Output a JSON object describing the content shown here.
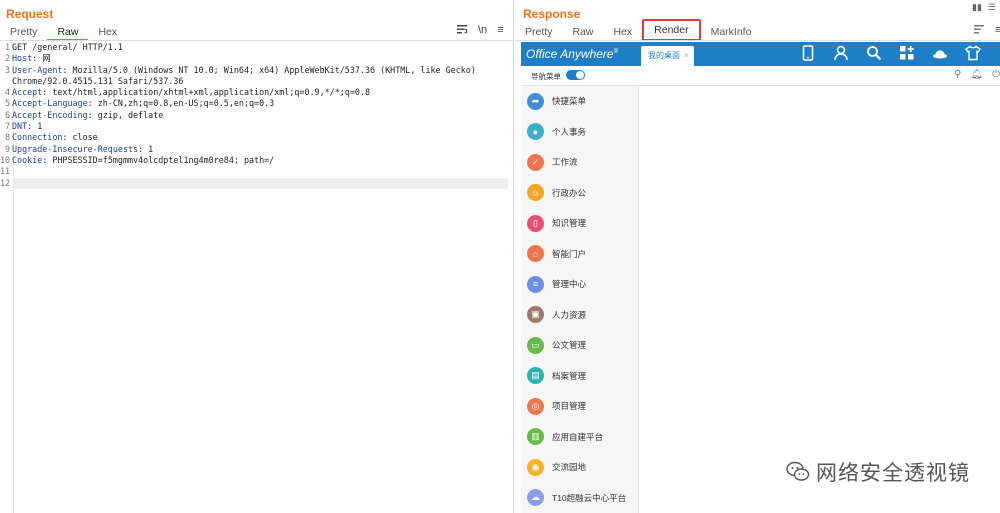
{
  "request": {
    "title": "Request",
    "tabs": [
      "Pretty",
      "Raw",
      "Hex"
    ],
    "active_tab": "Raw",
    "tools": [
      "wrap-icon",
      "newline-toggle",
      "menu-icon"
    ],
    "newline_label": "\\n",
    "lines": [
      {
        "n": "1",
        "key": "",
        "val": "GET /general/ HTTP/1.1"
      },
      {
        "n": "2",
        "key": "Host",
        "val": ": 网"
      },
      {
        "n": "3",
        "key": "User-Agent",
        "val": ": Mozilla/5.0 (Windows NT 10.0; Win64; x64) AppleWebKit/537.36 (KHTML, like Gecko)"
      },
      {
        "n": "",
        "key": "",
        "val": "Chrome/92.0.4515.131 Safari/537.36"
      },
      {
        "n": "4",
        "key": "Accept",
        "val": ": text/html,application/xhtml+xml,application/xml;q=0.9,*/*;q=0.8"
      },
      {
        "n": "5",
        "key": "Accept-Language",
        "val": ": zh-CN,zh;q=0.8,en-US;q=0.5,en;q=0.3"
      },
      {
        "n": "6",
        "key": "Accept-Encoding",
        "val": ": gzip, deflate"
      },
      {
        "n": "7",
        "key": "DNT",
        "val": ": 1"
      },
      {
        "n": "8",
        "key": "Connection",
        "val": ": close"
      },
      {
        "n": "9",
        "key": "Upgrade-Insecure-Requests",
        "val": ": 1"
      },
      {
        "n": "10",
        "key": "Cookie",
        "val": ": PHPSESSID=f5mgmmv4olcdptel1ng4m0re84; path=/"
      },
      {
        "n": "11",
        "key": "",
        "val": ""
      },
      {
        "n": "12",
        "key": "",
        "val": ""
      }
    ]
  },
  "response": {
    "title": "Response",
    "tabs": [
      "Pretty",
      "Raw",
      "Hex",
      "Render",
      "MarkInfo"
    ],
    "active_tab": "Render",
    "highlight_color": "#e53935",
    "render": {
      "app_title": "Office Anywhere",
      "app_title_sup": "®",
      "open_tab": "我的桌面",
      "open_tab_close": "×",
      "header_icons": [
        "phone-icon",
        "user-icon",
        "search-icon",
        "apps-icon",
        "hat-icon",
        "shirt-icon"
      ],
      "nav_label": "导航菜单",
      "nav_toggle_on": true,
      "accent": "#1e7ec8",
      "menu": [
        {
          "label": "快捷菜单",
          "icon": "quick-menu-icon",
          "color": "#3d8fd6",
          "glyph": "➦"
        },
        {
          "label": "个人事务",
          "icon": "person-icon",
          "color": "#3bb0c9",
          "glyph": "●"
        },
        {
          "label": "工作流",
          "icon": "workflow-icon",
          "color": "#f0754f",
          "glyph": "✓"
        },
        {
          "label": "行政办公",
          "icon": "admin-icon",
          "color": "#f5a623",
          "glyph": "☺"
        },
        {
          "label": "知识管理",
          "icon": "knowledge-icon",
          "color": "#e94e77",
          "glyph": "▯"
        },
        {
          "label": "智能门户",
          "icon": "portal-icon",
          "color": "#f0754f",
          "glyph": "⌂"
        },
        {
          "label": "管理中心",
          "icon": "manage-icon",
          "color": "#6c8ee8",
          "glyph": "≡"
        },
        {
          "label": "人力资源",
          "icon": "hr-icon",
          "color": "#9b7b6b",
          "glyph": "▣"
        },
        {
          "label": "公文管理",
          "icon": "document-icon",
          "color": "#66bb4a",
          "glyph": "▭"
        },
        {
          "label": "档案管理",
          "icon": "archive-icon",
          "color": "#2bb3b0",
          "glyph": "▤"
        },
        {
          "label": "项目管理",
          "icon": "project-icon",
          "color": "#f0754f",
          "glyph": "◎"
        },
        {
          "label": "应用自建平台",
          "icon": "app-builder-icon",
          "color": "#66bb4a",
          "glyph": "▥"
        },
        {
          "label": "交流园地",
          "icon": "chat-icon",
          "color": "#f5b323",
          "glyph": "◉"
        },
        {
          "label": "T10超融云中心平台",
          "icon": "cloud-icon",
          "color": "#8c9ee8",
          "glyph": "☁"
        }
      ]
    }
  },
  "watermark": {
    "text": "网络安全透视镜",
    "icon": "wechat-icon"
  }
}
